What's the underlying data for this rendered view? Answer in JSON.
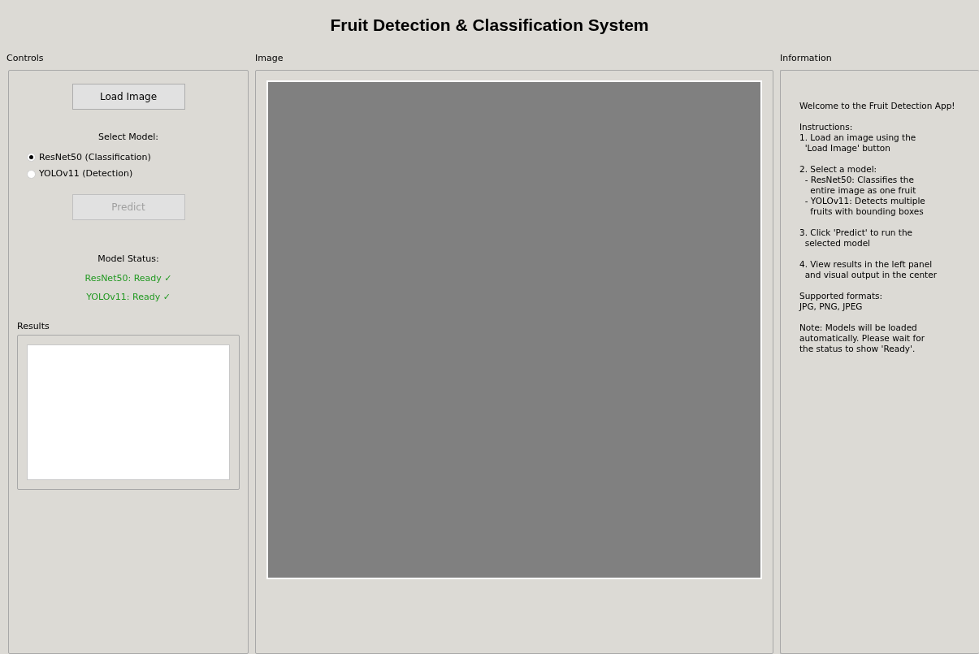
{
  "window": {
    "title": "Fruit Detection & Classification System"
  },
  "controls": {
    "label": "Controls",
    "load_button": {
      "label": "Load Image",
      "disabled": false
    },
    "select_label": "Select Model:",
    "models": [
      {
        "label": "ResNet50 (Classification)",
        "selected": true
      },
      {
        "label": "YOLOv11 (Detection)",
        "selected": false
      }
    ],
    "predict_button": {
      "label": "Predict",
      "disabled": true
    },
    "status_label": "Model Status:",
    "statuses": [
      {
        "text": "ResNet50: Ready ✓",
        "color": "#229922"
      },
      {
        "text": "YOLOv11: Ready ✓",
        "color": "#229922"
      }
    ],
    "results": {
      "label": "Results"
    }
  },
  "image": {
    "label": "Image"
  },
  "information": {
    "label": "Information",
    "paragraphs": [
      [
        "Welcome to the Fruit Detection App!"
      ],
      [
        "Instructions:",
        "1. Load an image using the",
        "  'Load Image' button"
      ],
      [
        "2. Select a model:",
        "  - ResNet50: Classifies the",
        "    entire image as one fruit",
        "  - YOLOv11: Detects multiple",
        "    fruits with bounding boxes"
      ],
      [
        "3. Click 'Predict' to run the",
        "  selected model"
      ],
      [
        "4. View results in the left panel",
        "  and visual output in the center"
      ],
      [
        "Supported formats:",
        "JPG, PNG, JPEG"
      ],
      [
        "Note: Models will be loaded",
        "automatically. Please wait for",
        "the status to show 'Ready'."
      ]
    ]
  }
}
